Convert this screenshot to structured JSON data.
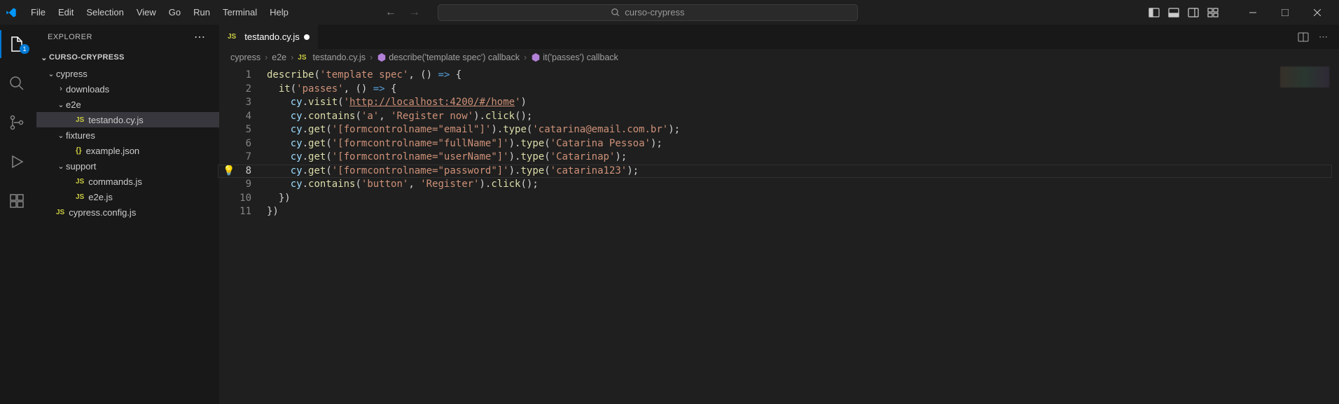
{
  "app": {
    "search_placeholder": "curso-crypress"
  },
  "menu": [
    "File",
    "Edit",
    "Selection",
    "View",
    "Go",
    "Run",
    "Terminal",
    "Help"
  ],
  "activity": {
    "explorer_badge": "1"
  },
  "sidebar": {
    "title": "EXPLORER",
    "root": "CURSO-CRYPRESS",
    "tree": [
      {
        "label": "cypress",
        "type": "folder",
        "open": true,
        "depth": 1
      },
      {
        "label": "downloads",
        "type": "folder",
        "open": false,
        "depth": 2
      },
      {
        "label": "e2e",
        "type": "folder",
        "open": true,
        "depth": 2
      },
      {
        "label": "testando.cy.js",
        "type": "js",
        "depth": 3,
        "selected": true
      },
      {
        "label": "fixtures",
        "type": "folder",
        "open": true,
        "depth": 2
      },
      {
        "label": "example.json",
        "type": "json",
        "depth": 3
      },
      {
        "label": "support",
        "type": "folder",
        "open": true,
        "depth": 2
      },
      {
        "label": "commands.js",
        "type": "js",
        "depth": 3
      },
      {
        "label": "e2e.js",
        "type": "js",
        "depth": 3
      },
      {
        "label": "cypress.config.js",
        "type": "js",
        "depth": 1
      }
    ]
  },
  "tab": {
    "name": "testando.cy.js",
    "dirty": true
  },
  "breadcrumbs": [
    {
      "label": "cypress",
      "kind": "folder"
    },
    {
      "label": "e2e",
      "kind": "folder"
    },
    {
      "label": "testando.cy.js",
      "kind": "js"
    },
    {
      "label": "describe('template spec') callback",
      "kind": "symbol"
    },
    {
      "label": "it('passes') callback",
      "kind": "symbol"
    }
  ],
  "editor": {
    "current_line": 8,
    "lines": [
      1,
      2,
      3,
      4,
      5,
      6,
      7,
      8,
      9,
      10,
      11
    ]
  },
  "code": {
    "l1_fn": "describe",
    "l1_str": "'template spec'",
    "l2_fn": "it",
    "l2_str": "'passes'",
    "l3_obj": "cy",
    "l3_fn": "visit",
    "l3_url": "http://localhost:4200/#/home",
    "l4_obj": "cy",
    "l4_fn1": "contains",
    "l4_s1": "'a'",
    "l4_s2": "'Register now'",
    "l4_fn2": "click",
    "l5_obj": "cy",
    "l5_fn1": "get",
    "l5_s1": "'[formcontrolname=\"email\"]'",
    "l5_fn2": "type",
    "l5_s2": "'catarina@email.com.br'",
    "l6_obj": "cy",
    "l6_fn1": "get",
    "l6_s1": "'[formcontrolname=\"fullName\"]'",
    "l6_fn2": "type",
    "l6_s2": "'Catarina Pessoa'",
    "l7_obj": "cy",
    "l7_fn1": "get",
    "l7_s1": "'[formcontrolname=\"userName\"]'",
    "l7_fn2": "type",
    "l7_s2": "'Catarinap'",
    "l8_obj": "cy",
    "l8_fn1": "get",
    "l8_s1": "'[formcontrolname=\"password\"]'",
    "l8_fn2": "type",
    "l8_s2": "'catarina123'",
    "l9_obj": "cy",
    "l9_fn1": "contains",
    "l9_s1": "'button'",
    "l9_s2": "'Register'",
    "l9_fn2": "click"
  }
}
